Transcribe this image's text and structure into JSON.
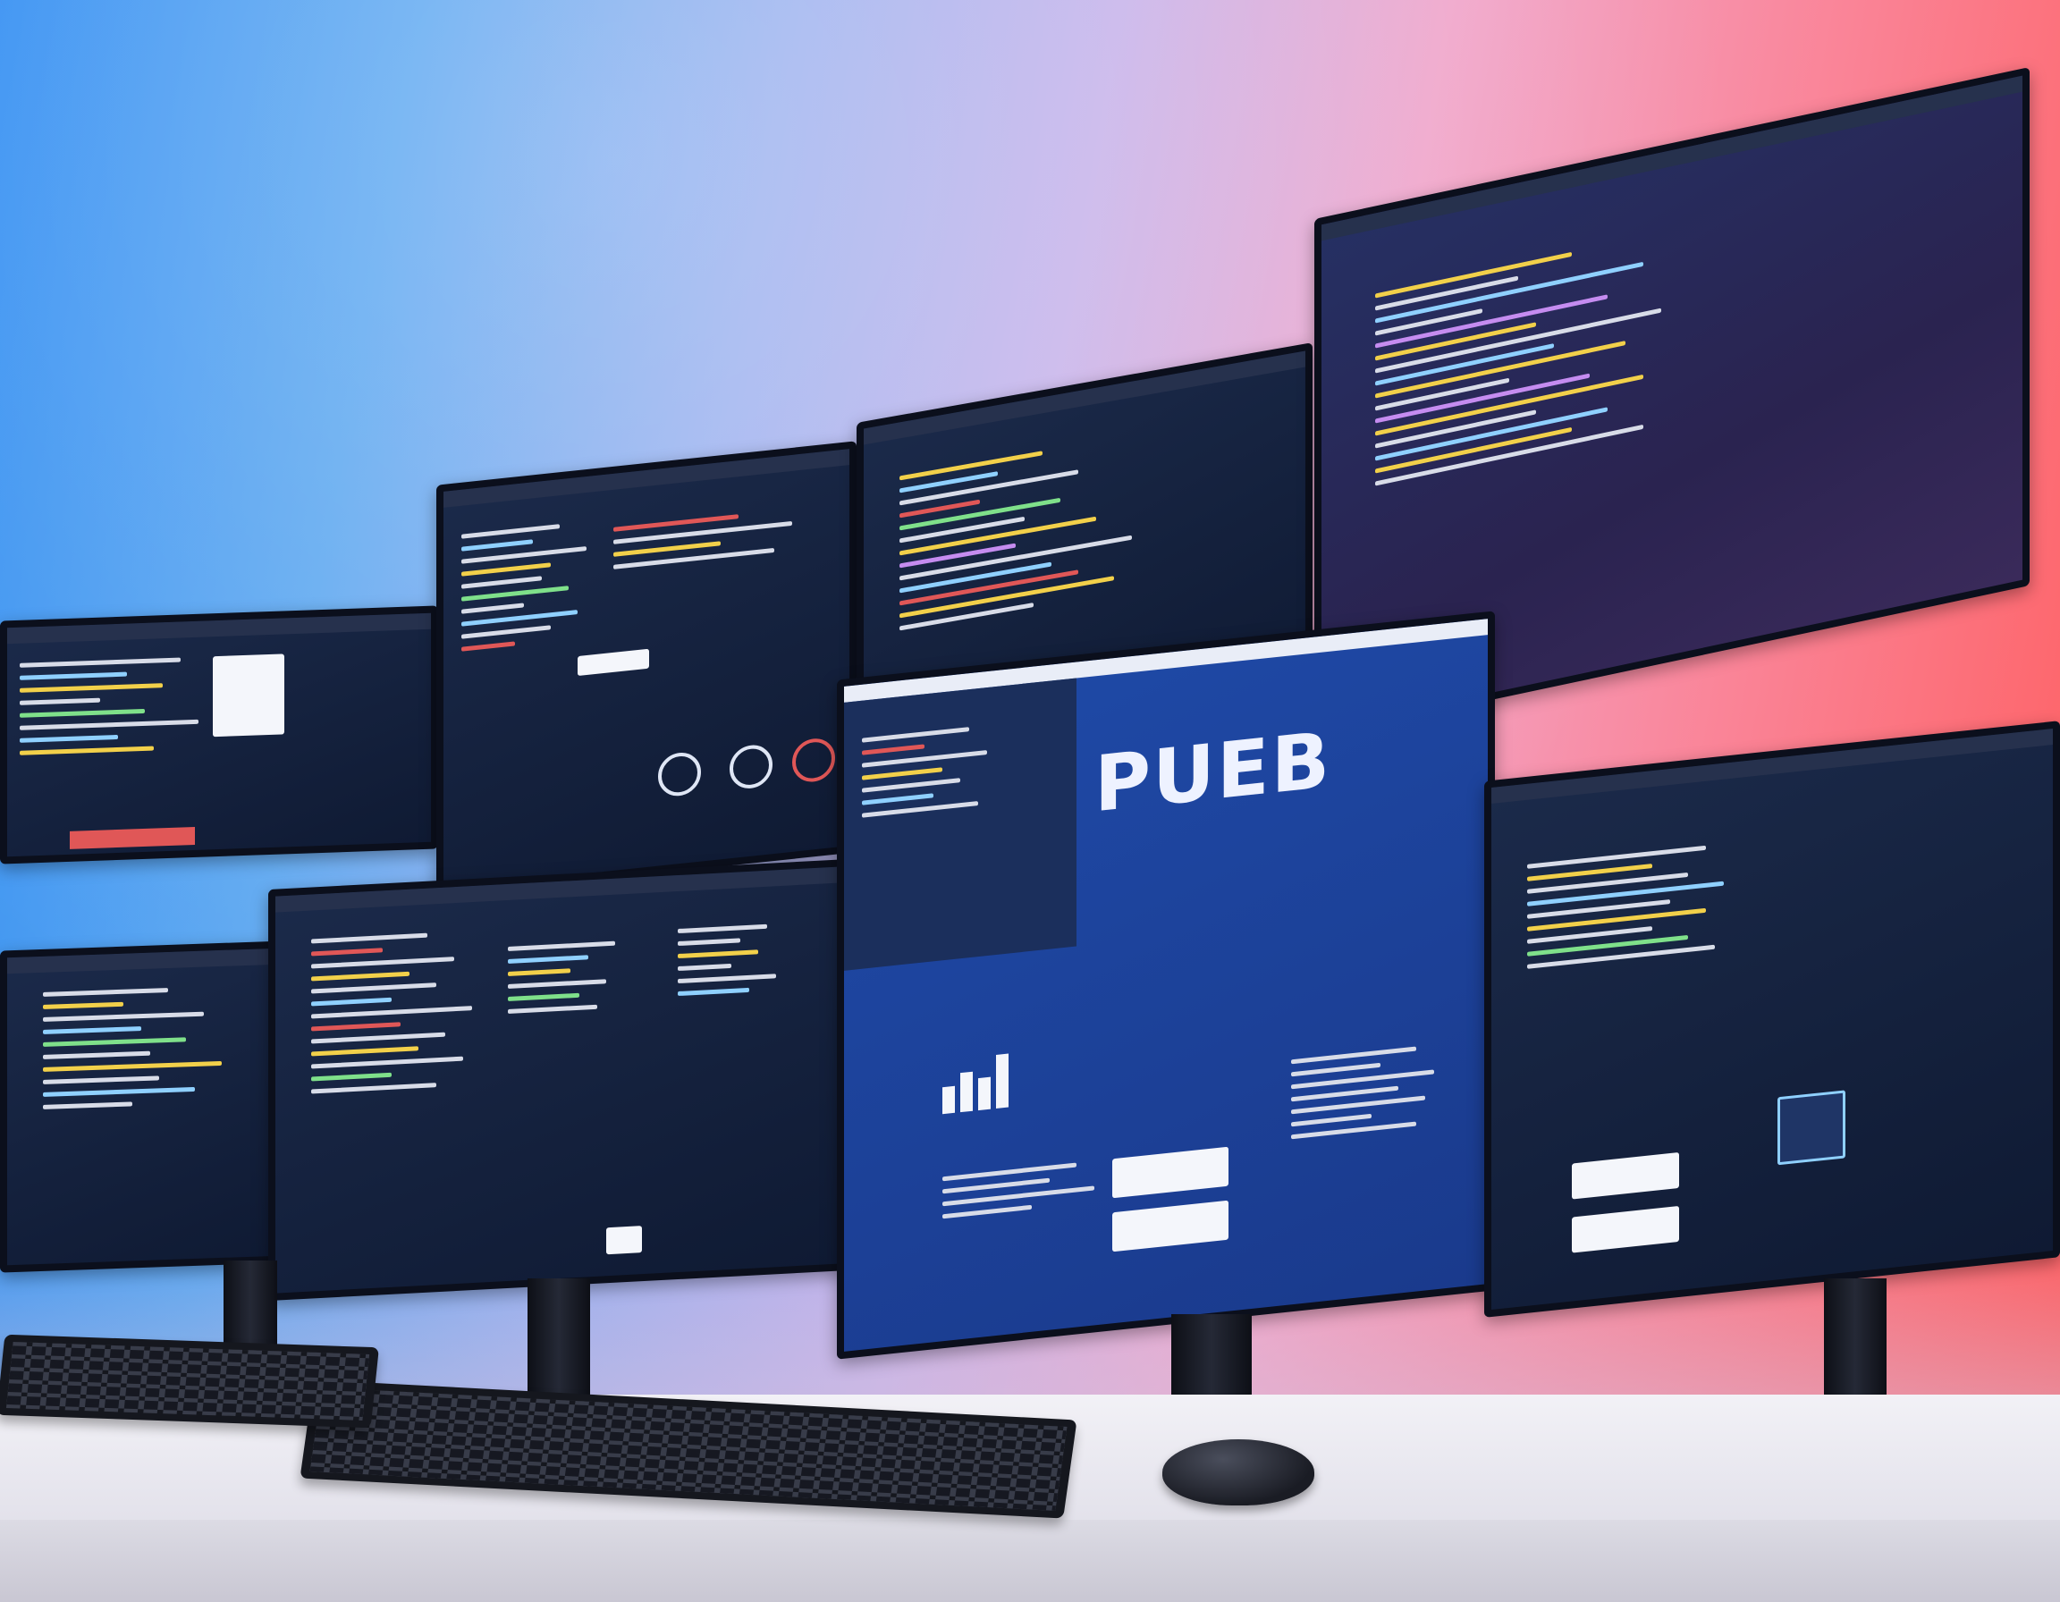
{
  "scene": {
    "description_text": "PUEB"
  },
  "colors": {
    "wall_left": "#2f8cf2",
    "wall_right": "#ff5a5a",
    "screen_bg": "#14233f",
    "desk": "#f2f1f6"
  },
  "icons": [
    "keyboard-icon",
    "mouse-icon",
    "bar-chart-icon"
  ]
}
